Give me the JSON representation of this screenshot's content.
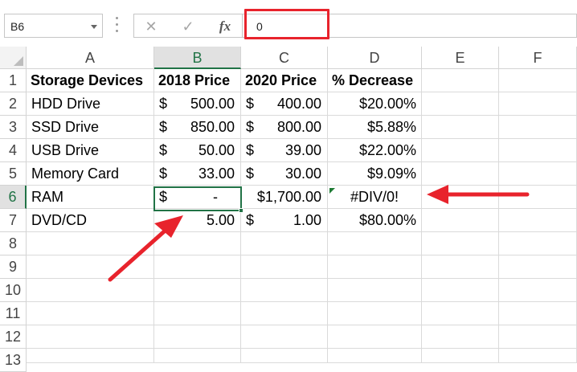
{
  "name_box": {
    "value": "B6"
  },
  "formula_bar": {
    "cancel_symbol": "✕",
    "enter_symbol": "✓",
    "fx_label": "fx",
    "value": "0"
  },
  "columns": [
    "A",
    "B",
    "C",
    "D",
    "E",
    "F"
  ],
  "selected_column": "B",
  "rows": [
    "1",
    "2",
    "3",
    "4",
    "5",
    "6",
    "7",
    "8",
    "9",
    "10",
    "11",
    "12",
    "13"
  ],
  "selected_row": "6",
  "headers": {
    "a": "Storage Devices",
    "b": "2018 Price",
    "c": "2020 Price",
    "d": "% Decrease"
  },
  "data_rows": [
    {
      "device": "HDD Drive",
      "p2018_cur": "$",
      "p2018": "500.00",
      "p2020_cur": "$",
      "p2020": "400.00",
      "decrease": "$20.00%"
    },
    {
      "device": "SSD Drive",
      "p2018_cur": "$",
      "p2018": "850.00",
      "p2020_cur": "$",
      "p2020": "800.00",
      "decrease": "$5.88%"
    },
    {
      "device": "USB Drive",
      "p2018_cur": "$",
      "p2018": "50.00",
      "p2020_cur": "$",
      "p2020": "39.00",
      "decrease": "$22.00%"
    },
    {
      "device": "Memory Card",
      "p2018_cur": "$",
      "p2018": "33.00",
      "p2020_cur": "$",
      "p2020": "30.00",
      "decrease": "$9.09%"
    },
    {
      "device": "RAM",
      "p2018_cur": "$",
      "p2018": "-",
      "p2020_cur": "",
      "p2020": "$1,700.00",
      "decrease": "#DIV/0!"
    },
    {
      "device": "DVD/CD",
      "p2018_cur": "",
      "p2018": "5.00",
      "p2020_cur": "$",
      "p2020": "1.00",
      "decrease": "$80.00%"
    }
  ],
  "colors": {
    "annotation_red": "#e8232c",
    "excel_green": "#217346",
    "grid_line": "#dadada"
  }
}
